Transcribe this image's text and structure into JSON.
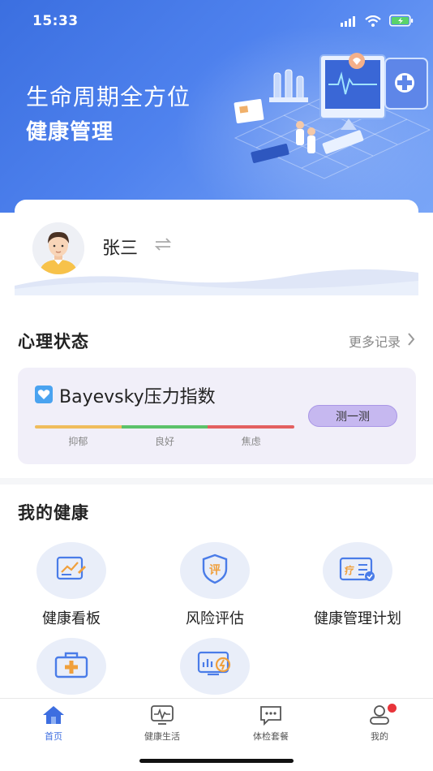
{
  "status_bar": {
    "time": "15:33"
  },
  "hero": {
    "line1": "生命周期全方位",
    "line2": "健康管理"
  },
  "profile": {
    "name": "张三",
    "avatar_icon": "user-avatar",
    "switch_icon": "swap-arrows-icon"
  },
  "psych": {
    "section_title": "心理状态",
    "more_label": "更多记录",
    "card_title": "Bayevsky压力指数",
    "measure_label": "测一测",
    "scale": [
      {
        "label": "抑郁",
        "color": "#f0bd5c"
      },
      {
        "label": "良好",
        "color": "#5cc26a"
      },
      {
        "label": "焦虑",
        "color": "#e36060"
      }
    ]
  },
  "health": {
    "section_title": "我的健康",
    "items": [
      {
        "label": "健康看板",
        "icon": "chart-board-icon"
      },
      {
        "label": "风险评估",
        "icon": "risk-assessment-icon"
      },
      {
        "label": "健康管理计划",
        "icon": "treatment-plan-icon"
      },
      {
        "label": "",
        "icon": "medical-kit-icon"
      },
      {
        "label": "",
        "icon": "monitor-report-icon"
      }
    ]
  },
  "tabbar": {
    "tabs": [
      {
        "label": "首页",
        "icon": "home-icon",
        "active": true
      },
      {
        "label": "健康生活",
        "icon": "ecg-monitor-icon",
        "active": false
      },
      {
        "label": "体检套餐",
        "icon": "chat-bubble-icon",
        "active": false
      },
      {
        "label": "我的",
        "icon": "profile-icon",
        "active": false,
        "badge": true
      }
    ]
  },
  "colors": {
    "accent": "#3d6ee0",
    "hero_blue": "#4a7ce8",
    "card_bg": "#f1eff9",
    "button_purple": "#c6b8f0"
  }
}
